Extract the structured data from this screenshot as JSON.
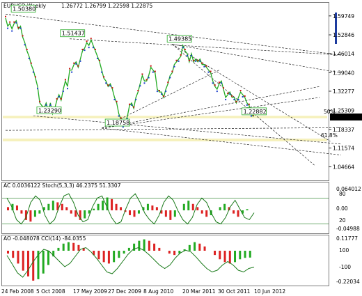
{
  "chart_data": [
    {
      "type": "line",
      "symbol": "EURUSD",
      "timeframe": "Weekly",
      "ohlc_header": "1.26772 1.26799 1.22598 1.22875",
      "xticks": [
        "24 Feb 2008",
        "5 Oct 2008",
        "17 May 2009",
        "27 Dec 2009",
        "8 Aug 2010",
        "20 Mar 2011",
        "30 Oct 2011",
        "10 Jun 2012"
      ],
      "yticks": [
        "1.59749",
        "1.52846",
        "1.46014",
        "1.39040",
        "1.32277",
        "1.25309",
        "1.22875",
        "1.18337",
        "1.11574",
        "1.04664"
      ],
      "ylim": [
        1.0,
        1.62
      ],
      "close_series": [
        1.59,
        1.56,
        1.57,
        1.55,
        1.57,
        1.58,
        1.55,
        1.56,
        1.52,
        1.5,
        1.47,
        1.45,
        1.42,
        1.4,
        1.37,
        1.34,
        1.28,
        1.27,
        1.26,
        1.28,
        1.25,
        1.28,
        1.24,
        1.26,
        1.29,
        1.31,
        1.29,
        1.33,
        1.36,
        1.34,
        1.4,
        1.4,
        1.42,
        1.43,
        1.41,
        1.44,
        1.47,
        1.48,
        1.5,
        1.49,
        1.51,
        1.49,
        1.47,
        1.45,
        1.43,
        1.4,
        1.37,
        1.36,
        1.34,
        1.35,
        1.33,
        1.3,
        1.28,
        1.24,
        1.22,
        1.2,
        1.21,
        1.23,
        1.27,
        1.28,
        1.26,
        1.3,
        1.32,
        1.35,
        1.38,
        1.36,
        1.36,
        1.38,
        1.41,
        1.4,
        1.39,
        1.33,
        1.32,
        1.32,
        1.3,
        1.33,
        1.35,
        1.38,
        1.39,
        1.42,
        1.43,
        1.44,
        1.45,
        1.49,
        1.47,
        1.46,
        1.43,
        1.46,
        1.43,
        1.44,
        1.43,
        1.44,
        1.42,
        1.42,
        1.41,
        1.4,
        1.39,
        1.36,
        1.34,
        1.33,
        1.35,
        1.36,
        1.33,
        1.3,
        1.31,
        1.32,
        1.3,
        1.3,
        1.28,
        1.3,
        1.32,
        1.31,
        1.3,
        1.28,
        1.27,
        1.24,
        1.23
      ],
      "fractal_labels": [
        {
          "text": "1.50380",
          "price": 1.604
        },
        {
          "text": "1.51437",
          "price": 1.514
        },
        {
          "text": "1.49385",
          "price": 1.494
        },
        {
          "text": "1.23290",
          "price": 1.233
        },
        {
          "text": "1.18758",
          "price": 1.188
        },
        {
          "text": "1.22882",
          "price": 1.229
        }
      ],
      "fib_levels": [
        {
          "text": "50%",
          "price": 1.236
        },
        {
          "text": "61.8%",
          "price": 1.15
        }
      ],
      "highlight_zones": [
        {
          "from": 1.224,
          "to": 1.233
        },
        {
          "from": 1.14,
          "to": 1.15
        }
      ],
      "current_price": "1.22875"
    },
    {
      "type": "line",
      "title": "AC 0.0036122  Stoch(5,3,3) 46.2375 51.3307",
      "yticks": [
        "0.064012",
        "80",
        "0.00",
        "20",
        "-0.04988"
      ],
      "values_ac": [
        0.01,
        0.02,
        0.015,
        -0.01,
        -0.03,
        -0.035,
        -0.02,
        -0.01,
        0.01,
        0.02,
        0.03,
        0.025,
        0.02,
        0.01,
        -0.01,
        -0.02,
        -0.03,
        -0.025,
        -0.01,
        0.005,
        0.02,
        0.03,
        0.04,
        0.035,
        0.02,
        0.01,
        -0.005,
        -0.015,
        -0.02,
        -0.01,
        0.01,
        0.02,
        0.015,
        0.01,
        -0.01,
        -0.02,
        -0.03,
        -0.02,
        0.0,
        0.02,
        0.03,
        0.02,
        0.01,
        -0.01,
        -0.02,
        -0.015,
        0.0,
        0.01,
        0.02,
        0.01,
        -0.01,
        -0.02,
        -0.01,
        0.0036
      ],
      "values_stoch": [
        80,
        60,
        30,
        20,
        35,
        70,
        85,
        75,
        40,
        20,
        30,
        60,
        85,
        90,
        70,
        40,
        25,
        30,
        60,
        80,
        85,
        60,
        35,
        20,
        25,
        55,
        80,
        90,
        70,
        45,
        30,
        20,
        40,
        70,
        85,
        75,
        50,
        30,
        20,
        35,
        65,
        80,
        70,
        45,
        25,
        20,
        35,
        60,
        75,
        55,
        35,
        30,
        46
      ]
    },
    {
      "type": "line",
      "title": "AO -0.048078  CCI(14) -84.0355",
      "yticks": [
        "0.11777",
        "100",
        "-100",
        "-0.22034"
      ],
      "values_ao": [
        -0.02,
        -0.05,
        -0.09,
        -0.14,
        -0.18,
        -0.21,
        -0.2,
        -0.16,
        -0.1,
        -0.04,
        0.02,
        0.05,
        0.06,
        0.055,
        0.04,
        0.02,
        0.0,
        -0.03,
        -0.06,
        -0.08,
        -0.09,
        -0.08,
        -0.05,
        -0.02,
        0.02,
        0.05,
        0.07,
        0.08,
        0.07,
        0.05,
        0.02,
        0.0,
        -0.02,
        -0.03,
        -0.02,
        0.01,
        0.04,
        0.06,
        0.05,
        0.03,
        0.0,
        -0.03,
        -0.06,
        -0.08,
        -0.09,
        -0.08,
        -0.06,
        -0.05,
        -0.048
      ],
      "values_cci": [
        50,
        -50,
        -150,
        -200,
        -120,
        -20,
        60,
        120,
        100,
        40,
        -20,
        -80,
        -40,
        40,
        120,
        140,
        90,
        20,
        -60,
        -140,
        -160,
        -100,
        -20,
        60,
        120,
        140,
        110,
        60,
        0,
        -60,
        -100,
        -60,
        20,
        80,
        110,
        90,
        30,
        -40,
        -100,
        -140,
        -120,
        -60,
        -20,
        -60,
        -120,
        -140,
        -100,
        -84
      ]
    }
  ]
}
